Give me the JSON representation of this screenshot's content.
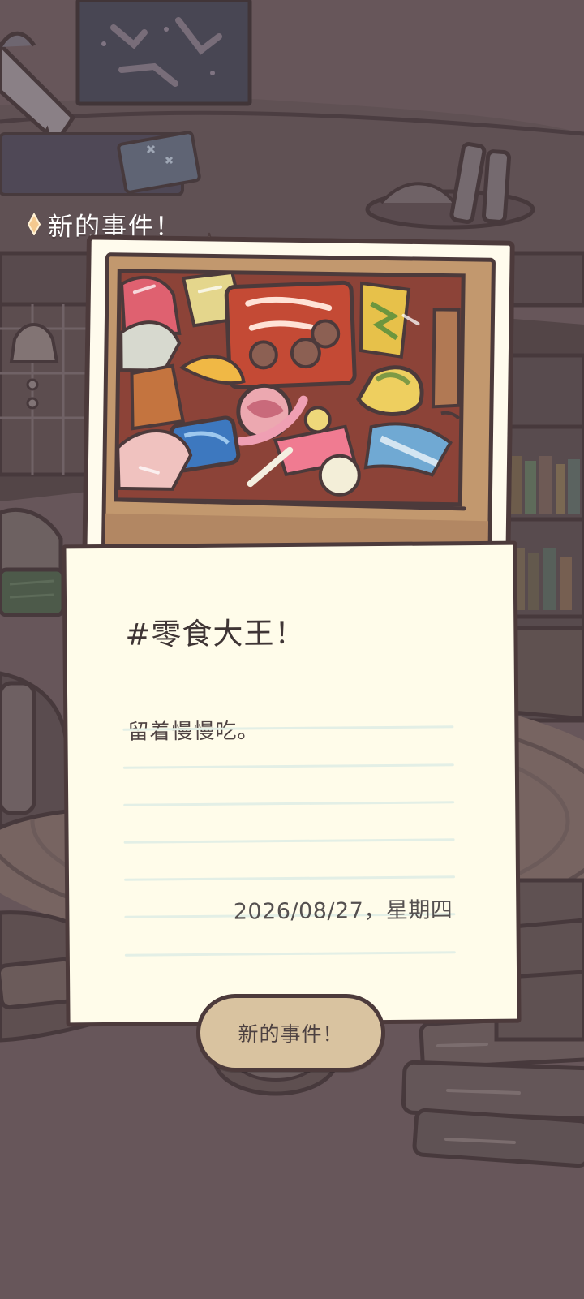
{
  "header": {
    "tag_text": "新的事件！",
    "accent_color": "#f4c98f"
  },
  "event": {
    "title": "#零食大王！",
    "memo": "留着慢慢吃。",
    "date": "2026/08/27，星期四"
  },
  "actions": {
    "new_event_button": "新的事件！"
  },
  "icons": {
    "header_diamond": "diamond-icon",
    "sparkle": "sparkle-icon"
  },
  "colors": {
    "background": "#67565a",
    "card_paper": "#fffcea",
    "outline": "#4c3a3b",
    "button": "#d9c3a0"
  }
}
